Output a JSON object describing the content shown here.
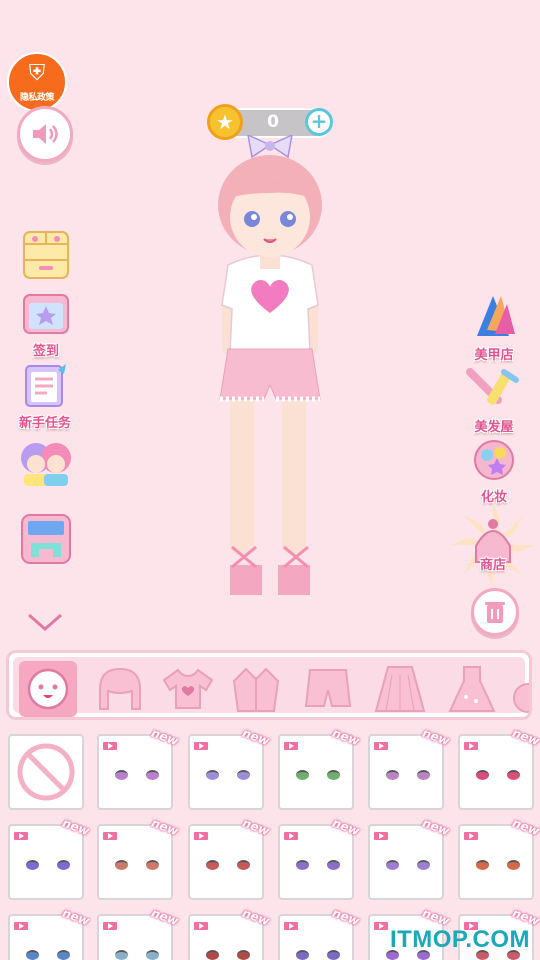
{
  "privacy": {
    "label": "隐私政策"
  },
  "coins": {
    "value": "0"
  },
  "left_menu": [
    {
      "name": "wardrobe-button",
      "label": ""
    },
    {
      "name": "checkin-button",
      "label": "签到"
    },
    {
      "name": "newbie-tasks-button",
      "label": "新手任务"
    },
    {
      "name": "friends-button",
      "label": ""
    },
    {
      "name": "gallery-button",
      "label": ""
    }
  ],
  "right_menu": [
    {
      "name": "nail-shop-button",
      "label": "美甲店"
    },
    {
      "name": "hair-salon-button",
      "label": "美发屋"
    },
    {
      "name": "makeup-button",
      "label": "化妆"
    },
    {
      "name": "shop-button",
      "label": "商店"
    }
  ],
  "tabs": [
    "face",
    "hair",
    "top",
    "jacket",
    "shorts",
    "skirt",
    "dress",
    "accessory"
  ],
  "grid": {
    "rows": [
      [
        {
          "none": true
        },
        {
          "new": "new",
          "eye": "#b87fd0"
        },
        {
          "new": "new",
          "eye": "#9c8fd8"
        },
        {
          "new": "new",
          "eye": "#6fae6f"
        },
        {
          "new": "new",
          "eye": "#b884c4"
        },
        {
          "new": "new",
          "eye": "#d84f7a"
        }
      ],
      [
        {
          "new": "new",
          "eye": "#7f6ad0"
        },
        {
          "new": "new",
          "eye": "#c97a6a"
        },
        {
          "new": "new",
          "eye": "#c45a5a"
        },
        {
          "new": "new",
          "eye": "#8b6fc4"
        },
        {
          "new": "new",
          "eye": "#9c7fd0"
        },
        {
          "new": "new",
          "eye": "#d06a4a"
        }
      ],
      [
        {
          "new": "new",
          "eye": "#5a86c4"
        },
        {
          "new": "new",
          "eye": "#88b0c8"
        },
        {
          "new": "new",
          "eye": "#b04a4a"
        },
        {
          "new": "new",
          "eye": "#7a6ac0"
        },
        {
          "new": "new",
          "eye": "#9a6ad0"
        },
        {
          "new": "new",
          "eye": "#c85a6a"
        }
      ]
    ]
  },
  "watermark": "ITMOP.COM"
}
